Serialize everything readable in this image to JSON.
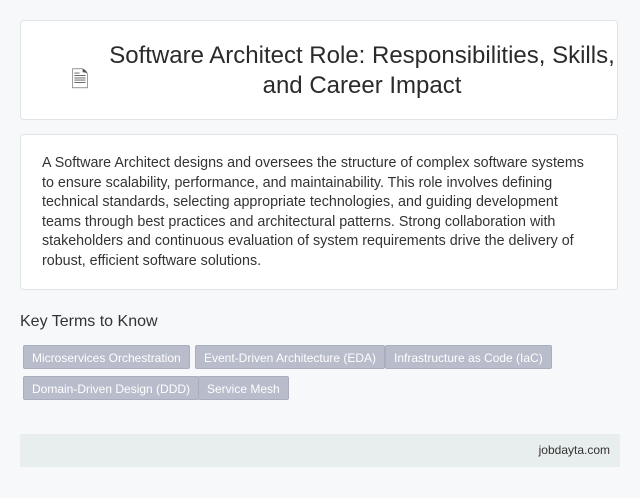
{
  "header": {
    "icon": "document-icon",
    "title": "Software Architect Role: Responsibilities, Skills, and Career Impact"
  },
  "summary": {
    "text": "A Software Architect designs and oversees the structure of complex software systems to ensure scalability, performance, and maintainability. This role involves defining technical standards, selecting appropriate technologies, and guiding development teams through best practices and architectural patterns. Strong collaboration with stakeholders and continuous evaluation of system requirements drive the delivery of robust, efficient software solutions."
  },
  "key_terms": {
    "heading": "Key Terms to Know",
    "terms": [
      "Microservices Orchestration",
      "Event-Driven Architecture (EDA)",
      "Infrastructure as Code (IaC)",
      "Domain-Driven Design (DDD)",
      "Service Mesh"
    ]
  },
  "footer": {
    "site": "jobdayta.com"
  },
  "colors": {
    "chip_bg": "#b8bccb",
    "footer_bg": "#e8eeed",
    "page_bg": "#f6f8f9"
  }
}
